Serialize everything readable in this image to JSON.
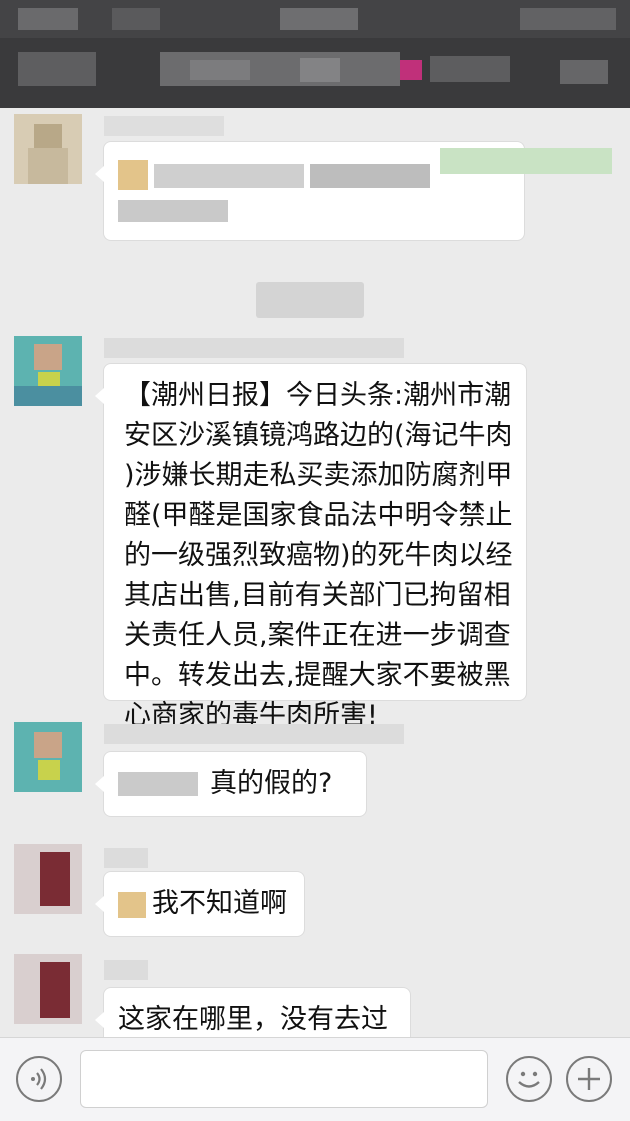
{
  "header": {
    "title_obscured": true
  },
  "messages": [
    {
      "id": "m1",
      "sender_obscured": true,
      "text_obscured": true
    },
    {
      "id": "m2",
      "text": "【潮州日报】今日头条:潮州市潮安区沙溪镇镜鸿路边的(海记牛肉)涉嫌长期走私买卖添加防腐剂甲醛(甲醛是国家食品法中明令禁止的一级强烈致癌物)的死牛肉以经其店出售,目前有关部门已拘留相关责任人员,案件正在进一步调查中。转发出去,提醒大家不要被黑心商家的毒牛肉所害!",
      "lines": [
        "【潮州日报】今日头条:潮州市潮",
        "安区沙溪镇镜鸿路边的(海记牛肉",
        ")涉嫌长期走私买卖添加防腐剂甲",
        "醛(甲醛是国家食品法中明令禁止",
        "的一级强烈致癌物)的死牛肉以经",
        "其店出售,目前有关部门已拘留相",
        "关责任人员,案件正在进一步调查",
        "中。转发出去,提醒大家不要被黑",
        "心商家的毒牛肉所害!"
      ]
    },
    {
      "id": "m3",
      "text": "真的假的?"
    },
    {
      "id": "m4",
      "text": "我不知道啊"
    },
    {
      "id": "m5",
      "text": "这家在哪里，没有去过"
    }
  ],
  "footer": {
    "voice_icon": "voice-icon",
    "emoji_icon": "emoji-icon",
    "add_icon": "plus-icon",
    "input_value": ""
  },
  "colors": {
    "header_bg": "#3a3a3c",
    "chat_bg": "#ebebeb",
    "bubble_bg": "#ffffff",
    "footer_bg": "#f4f4f6"
  }
}
